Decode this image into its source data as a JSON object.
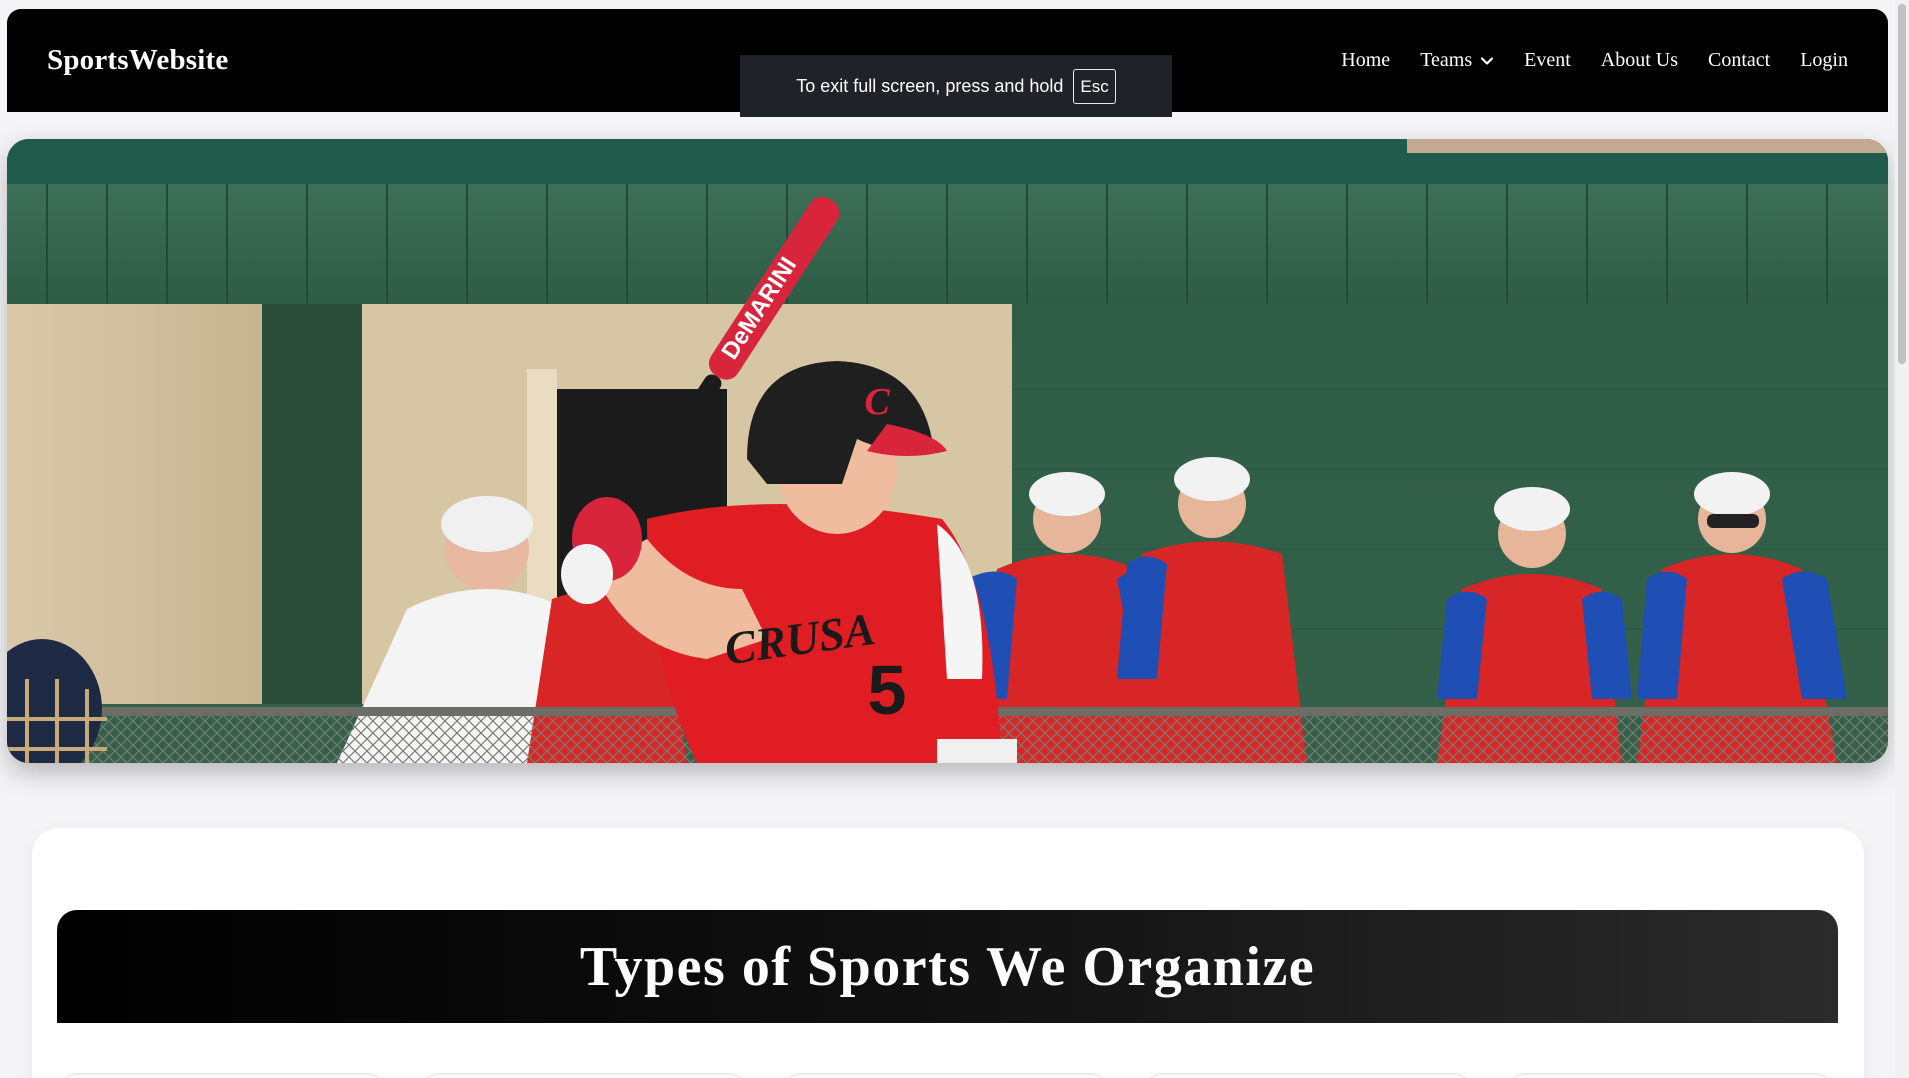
{
  "navbar": {
    "brand": "SportsWebsite",
    "links": {
      "home": "Home",
      "teams": "Teams",
      "event": "Event",
      "about": "About Us",
      "contact": "Contact",
      "login": "Login"
    },
    "teams_icon": "chevron-down-icon"
  },
  "fullscreen_notice": {
    "text": "To exit full screen, press and hold",
    "key": "Esc"
  },
  "hero": {
    "image": "baseball-batter-photo",
    "jersey_number": "5",
    "bat_text": "DeMARINI",
    "jersey_text": "CRUSA"
  },
  "sports_section": {
    "title": "Types of Sports We Organize"
  },
  "colors": {
    "navbar_bg": "#000000",
    "page_bg": "#f4f4f7",
    "banner_text": "#ffffff"
  }
}
